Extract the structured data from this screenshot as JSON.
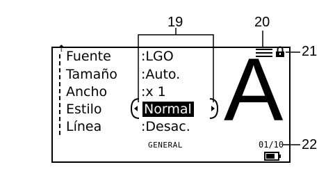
{
  "screen": {
    "rows": [
      {
        "label": "Fuente",
        "value": ":LGO"
      },
      {
        "label": "Tamaño",
        "value": ":Auto."
      },
      {
        "label": "Ancho",
        "value": ":x 1"
      },
      {
        "label": "Estilo",
        "value": "Normal"
      },
      {
        "label": "Línea",
        "value": ":Desac."
      }
    ],
    "preview_char": "A",
    "mode": "GENERAL",
    "page_counter": "01/10"
  },
  "callouts": {
    "c19": "19",
    "c20": "20",
    "c21": "21",
    "c22": "22"
  },
  "icons": {
    "scroll": "scroll-up-arrow-icon",
    "left": "left-arrow-icon",
    "right": "right-arrow-icon",
    "menu": "menu-lines-icon",
    "lock": "lock-icon",
    "battery": "battery-icon"
  },
  "battery_level": 0.75,
  "colors": {
    "ink": "#000000",
    "background": "#ffffff"
  }
}
